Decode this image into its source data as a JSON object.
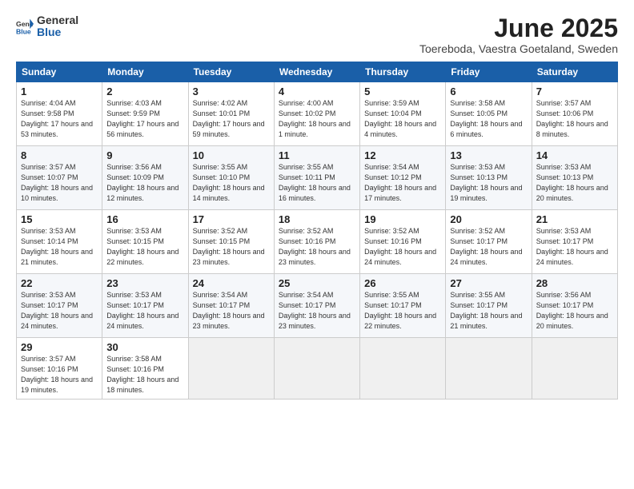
{
  "logo": {
    "general": "General",
    "blue": "Blue"
  },
  "title": "June 2025",
  "subtitle": "Toereboda, Vaestra Goetaland, Sweden",
  "weekdays": [
    "Sunday",
    "Monday",
    "Tuesday",
    "Wednesday",
    "Thursday",
    "Friday",
    "Saturday"
  ],
  "weeks": [
    [
      {
        "day": "1",
        "sunrise": "4:04 AM",
        "sunset": "9:58 PM",
        "daylight": "17 hours and 53 minutes."
      },
      {
        "day": "2",
        "sunrise": "4:03 AM",
        "sunset": "9:59 PM",
        "daylight": "17 hours and 56 minutes."
      },
      {
        "day": "3",
        "sunrise": "4:02 AM",
        "sunset": "10:01 PM",
        "daylight": "17 hours and 59 minutes."
      },
      {
        "day": "4",
        "sunrise": "4:00 AM",
        "sunset": "10:02 PM",
        "daylight": "18 hours and 1 minute."
      },
      {
        "day": "5",
        "sunrise": "3:59 AM",
        "sunset": "10:04 PM",
        "daylight": "18 hours and 4 minutes."
      },
      {
        "day": "6",
        "sunrise": "3:58 AM",
        "sunset": "10:05 PM",
        "daylight": "18 hours and 6 minutes."
      },
      {
        "day": "7",
        "sunrise": "3:57 AM",
        "sunset": "10:06 PM",
        "daylight": "18 hours and 8 minutes."
      }
    ],
    [
      {
        "day": "8",
        "sunrise": "3:57 AM",
        "sunset": "10:07 PM",
        "daylight": "18 hours and 10 minutes."
      },
      {
        "day": "9",
        "sunrise": "3:56 AM",
        "sunset": "10:09 PM",
        "daylight": "18 hours and 12 minutes."
      },
      {
        "day": "10",
        "sunrise": "3:55 AM",
        "sunset": "10:10 PM",
        "daylight": "18 hours and 14 minutes."
      },
      {
        "day": "11",
        "sunrise": "3:55 AM",
        "sunset": "10:11 PM",
        "daylight": "18 hours and 16 minutes."
      },
      {
        "day": "12",
        "sunrise": "3:54 AM",
        "sunset": "10:12 PM",
        "daylight": "18 hours and 17 minutes."
      },
      {
        "day": "13",
        "sunrise": "3:53 AM",
        "sunset": "10:13 PM",
        "daylight": "18 hours and 19 minutes."
      },
      {
        "day": "14",
        "sunrise": "3:53 AM",
        "sunset": "10:13 PM",
        "daylight": "18 hours and 20 minutes."
      }
    ],
    [
      {
        "day": "15",
        "sunrise": "3:53 AM",
        "sunset": "10:14 PM",
        "daylight": "18 hours and 21 minutes."
      },
      {
        "day": "16",
        "sunrise": "3:53 AM",
        "sunset": "10:15 PM",
        "daylight": "18 hours and 22 minutes."
      },
      {
        "day": "17",
        "sunrise": "3:52 AM",
        "sunset": "10:15 PM",
        "daylight": "18 hours and 23 minutes."
      },
      {
        "day": "18",
        "sunrise": "3:52 AM",
        "sunset": "10:16 PM",
        "daylight": "18 hours and 23 minutes."
      },
      {
        "day": "19",
        "sunrise": "3:52 AM",
        "sunset": "10:16 PM",
        "daylight": "18 hours and 24 minutes."
      },
      {
        "day": "20",
        "sunrise": "3:52 AM",
        "sunset": "10:17 PM",
        "daylight": "18 hours and 24 minutes."
      },
      {
        "day": "21",
        "sunrise": "3:53 AM",
        "sunset": "10:17 PM",
        "daylight": "18 hours and 24 minutes."
      }
    ],
    [
      {
        "day": "22",
        "sunrise": "3:53 AM",
        "sunset": "10:17 PM",
        "daylight": "18 hours and 24 minutes."
      },
      {
        "day": "23",
        "sunrise": "3:53 AM",
        "sunset": "10:17 PM",
        "daylight": "18 hours and 24 minutes."
      },
      {
        "day": "24",
        "sunrise": "3:54 AM",
        "sunset": "10:17 PM",
        "daylight": "18 hours and 23 minutes."
      },
      {
        "day": "25",
        "sunrise": "3:54 AM",
        "sunset": "10:17 PM",
        "daylight": "18 hours and 23 minutes."
      },
      {
        "day": "26",
        "sunrise": "3:55 AM",
        "sunset": "10:17 PM",
        "daylight": "18 hours and 22 minutes."
      },
      {
        "day": "27",
        "sunrise": "3:55 AM",
        "sunset": "10:17 PM",
        "daylight": "18 hours and 21 minutes."
      },
      {
        "day": "28",
        "sunrise": "3:56 AM",
        "sunset": "10:17 PM",
        "daylight": "18 hours and 20 minutes."
      }
    ],
    [
      {
        "day": "29",
        "sunrise": "3:57 AM",
        "sunset": "10:16 PM",
        "daylight": "18 hours and 19 minutes."
      },
      {
        "day": "30",
        "sunrise": "3:58 AM",
        "sunset": "10:16 PM",
        "daylight": "18 hours and 18 minutes."
      },
      null,
      null,
      null,
      null,
      null
    ]
  ],
  "labels": {
    "sunrise": "Sunrise:",
    "sunset": "Sunset:",
    "daylight": "Daylight:"
  }
}
